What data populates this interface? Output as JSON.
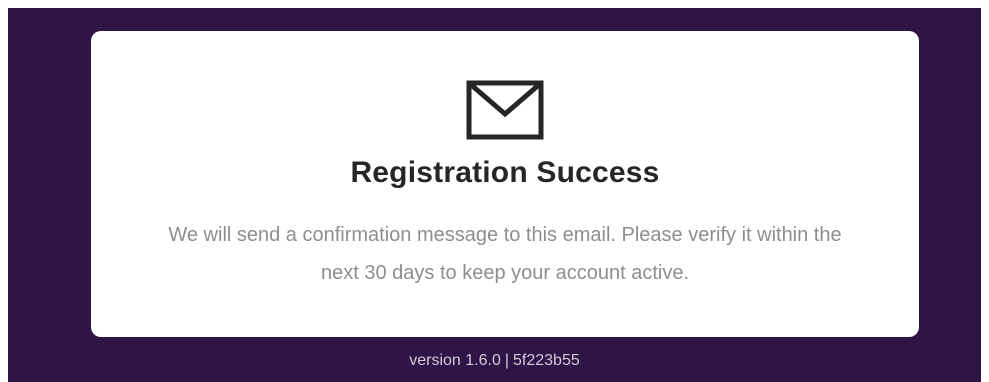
{
  "dialog": {
    "icon": "envelope-icon",
    "title": "Registration Success",
    "message": "We will send a confirmation message to this email. Please verify it within the next 30 days to keep your account active."
  },
  "footer": {
    "version": "version 1.6.0",
    "separator": "|",
    "build": "5f223b55"
  },
  "colors": {
    "background": "#2e1546",
    "card": "#ffffff",
    "title": "#262626",
    "message": "#8e8e8e",
    "footer_text": "#d2cbd8"
  }
}
